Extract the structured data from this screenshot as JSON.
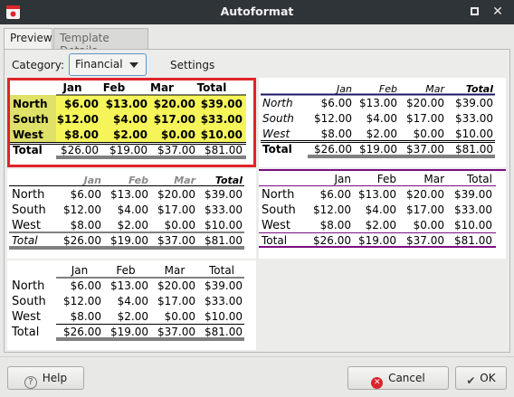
{
  "window": {
    "title": "Autoformat"
  },
  "tabs": [
    "Preview",
    "Template Details"
  ],
  "category": {
    "label": "Category:",
    "value": "Financial"
  },
  "settings_label": "Settings",
  "table": {
    "headers": [
      "Jan",
      "Feb",
      "Mar",
      "Total"
    ],
    "rows": [
      {
        "label": "North",
        "values": [
          "$6.00",
          "$13.00",
          "$20.00",
          "$39.00"
        ]
      },
      {
        "label": "South",
        "values": [
          "$12.00",
          "$4.00",
          "$17.00",
          "$33.00"
        ]
      },
      {
        "label": "West",
        "values": [
          "$8.00",
          "$2.00",
          "$0.00",
          "$10.00"
        ]
      }
    ],
    "total": {
      "label": "Total",
      "values": [
        "$26.00",
        "$19.00",
        "$37.00",
        "$81.00"
      ]
    }
  },
  "buttons": {
    "help": "Help",
    "cancel": "Cancel",
    "ok": "OK"
  },
  "colors": {
    "selected_border": "#e0242b",
    "highlight": "#f5f55a",
    "row_label_bg": "#dfe168",
    "navy": "#1c1566",
    "purple": "#7a0f80"
  }
}
